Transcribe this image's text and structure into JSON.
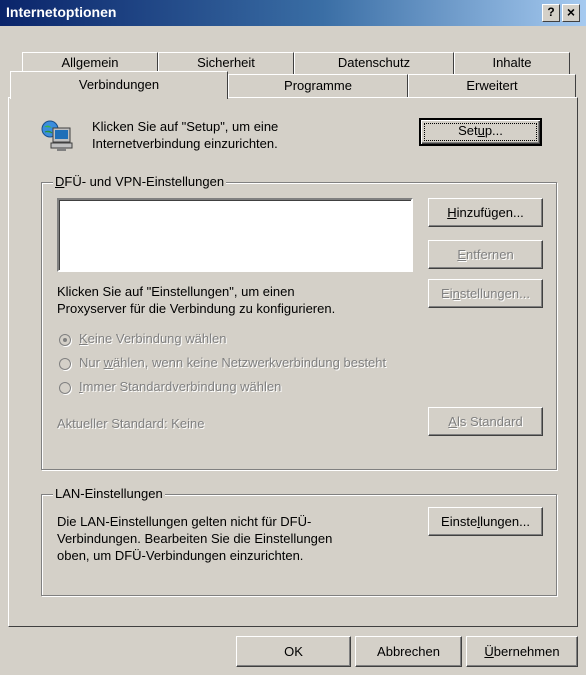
{
  "window": {
    "title": "Internetoptionen",
    "help_glyph": "?",
    "close_glyph": "×"
  },
  "tabs": {
    "row1": [
      "Allgemein",
      "Sicherheit",
      "Datenschutz",
      "Inhalte"
    ],
    "row2": [
      "Verbindungen",
      "Programme",
      "Erweitert"
    ],
    "active": "Verbindungen"
  },
  "setup": {
    "text_line1": "Klicken Sie auf \"Setup\", um eine",
    "text_line2": "Internetverbindung einzurichten.",
    "button_pre": "Set",
    "button_ul": "u",
    "button_post": "p...",
    "icon": "network-computer-icon"
  },
  "dialup": {
    "group_ul": "D",
    "group_post": "FÜ- und VPN-Einstellungen",
    "add_ul": "H",
    "add_post": "inzufügen...",
    "remove_ul": "E",
    "remove_post": "ntfernen",
    "settings_pre": "Ei",
    "settings_ul": "n",
    "settings_post": "stellungen...",
    "proxy_line1": "Klicken Sie auf \"Einstellungen\", um einen",
    "proxy_line2": "Proxyserver für die Verbindung zu konfigurieren.",
    "radio1_ul": "K",
    "radio1_post": "eine Verbindung wählen",
    "radio2_pre": "Nur ",
    "radio2_ul": "w",
    "radio2_post": "ählen, wenn keine Netzwerkverbindung besteht",
    "radio3_ul": "I",
    "radio3_post": "mmer Standardverbindung wählen",
    "current_default": "Aktueller Standard:  Keine",
    "set_default_ul": "A",
    "set_default_post": "ls Standard"
  },
  "lan": {
    "group_label": "LAN-Einstellungen",
    "text_line1": "Die LAN-Einstellungen gelten nicht für DFÜ-",
    "text_line2": "Verbindungen. Bearbeiten Sie die Einstellungen",
    "text_line3": "oben, um DFÜ-Verbindungen einzurichten.",
    "button_pre": "Einste",
    "button_ul": "l",
    "button_post": "lungen..."
  },
  "footer": {
    "ok": "OK",
    "cancel": "Abbrechen",
    "apply_ul": "Ü",
    "apply_post": "bernehmen"
  }
}
